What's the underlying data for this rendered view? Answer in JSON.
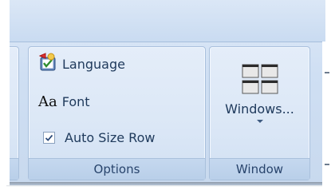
{
  "options_group": {
    "title": "Options",
    "items": [
      {
        "label": "Language",
        "icon": "language-icon"
      },
      {
        "label": "Font",
        "icon": "font-aa-icon",
        "glyph": "Aa"
      },
      {
        "label": "Auto Size Row",
        "icon": "checkbox",
        "checked": true
      }
    ]
  },
  "window_group": {
    "title": "Window",
    "button_label": "Windows...",
    "icon": "window-tiles-icon"
  }
}
